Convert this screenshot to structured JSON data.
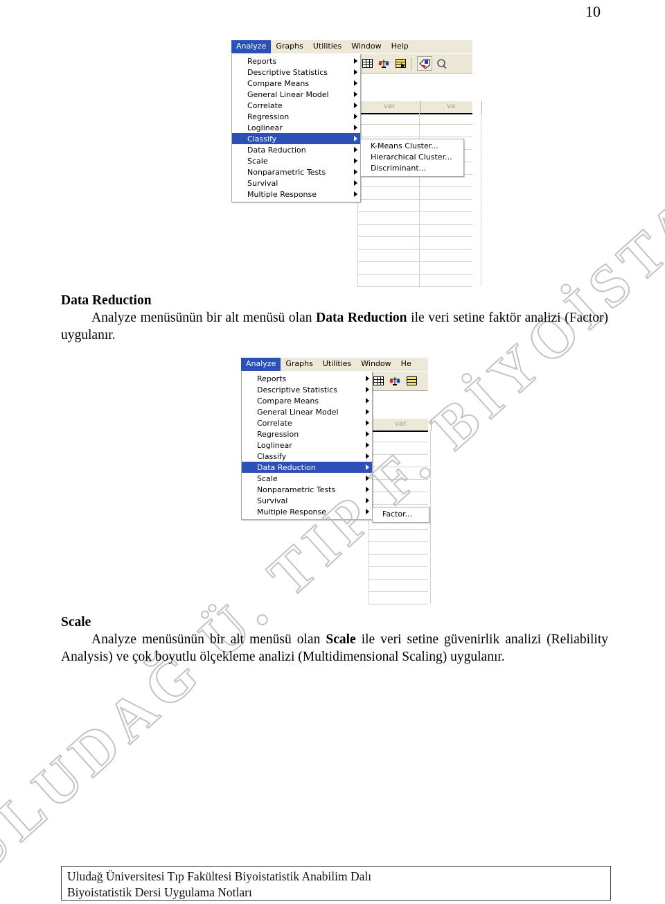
{
  "page": {
    "number": "10",
    "watermark": "ULUDAĞ Ü. TIP F. BİYOİSTATİSTİK A.D."
  },
  "screenshot_classify": {
    "name": "spss-analyze-menu-classify",
    "menubar": [
      {
        "label": "Analyze",
        "active": true
      },
      {
        "label": "Graphs",
        "active": false
      },
      {
        "label": "Utilities",
        "active": false
      },
      {
        "label": "Window",
        "active": false
      },
      {
        "label": "Help",
        "active": false
      }
    ],
    "menu_items": [
      {
        "label": "Reports",
        "selected": false
      },
      {
        "label": "Descriptive Statistics",
        "selected": false
      },
      {
        "label": "Compare Means",
        "selected": false
      },
      {
        "label": "General Linear Model",
        "selected": false
      },
      {
        "label": "Correlate",
        "selected": false
      },
      {
        "label": "Regression",
        "selected": false
      },
      {
        "label": "Loglinear",
        "selected": false
      },
      {
        "label": "Classify",
        "selected": true
      },
      {
        "label": "Data Reduction",
        "selected": false
      },
      {
        "label": "Scale",
        "selected": false
      },
      {
        "label": "Nonparametric Tests",
        "selected": false
      },
      {
        "label": "Survival",
        "selected": false
      },
      {
        "label": "Multiple Response",
        "selected": false
      }
    ],
    "submenu_items": [
      {
        "label": "K-Means Cluster..."
      },
      {
        "label": "Hierarchical Cluster..."
      },
      {
        "label": "Discriminant..."
      }
    ],
    "column_headers": [
      "var",
      "va"
    ],
    "toolbar_icons": [
      "data-grid-icon",
      "weighted-cases-icon",
      "insert-variable-icon",
      "value-labels-icon",
      "find-icon"
    ]
  },
  "screenshot_datareduction": {
    "name": "spss-analyze-menu-data-reduction",
    "menubar": [
      {
        "label": "Analyze",
        "active": true
      },
      {
        "label": "Graphs",
        "active": false
      },
      {
        "label": "Utilities",
        "active": false
      },
      {
        "label": "Window",
        "active": false
      },
      {
        "label": "He",
        "active": false
      }
    ],
    "menu_items": [
      {
        "label": "Reports",
        "selected": false
      },
      {
        "label": "Descriptive Statistics",
        "selected": false
      },
      {
        "label": "Compare Means",
        "selected": false
      },
      {
        "label": "General Linear Model",
        "selected": false
      },
      {
        "label": "Correlate",
        "selected": false
      },
      {
        "label": "Regression",
        "selected": false
      },
      {
        "label": "Loglinear",
        "selected": false
      },
      {
        "label": "Classify",
        "selected": false
      },
      {
        "label": "Data Reduction",
        "selected": true
      },
      {
        "label": "Scale",
        "selected": false
      },
      {
        "label": "Nonparametric Tests",
        "selected": false
      },
      {
        "label": "Survival",
        "selected": false
      },
      {
        "label": "Multiple Response",
        "selected": false
      }
    ],
    "submenu_items": [
      {
        "label": "Factor..."
      }
    ],
    "column_headers": [
      "var"
    ],
    "toolbar_icons": [
      "data-grid-icon",
      "weighted-cases-icon",
      "insert-variable-icon"
    ]
  },
  "section_data_reduction": {
    "heading": "Data Reduction",
    "paragraph_pre": "Analyze menüsünün bir alt menüsü olan ",
    "paragraph_bold": "Data Reduction",
    "paragraph_post": " ile veri setine faktör analizi (Factor) uygulanır."
  },
  "section_scale": {
    "heading": "Scale",
    "paragraph_pre": "Analyze menüsünün bir alt menüsü olan ",
    "paragraph_bold": "Scale",
    "paragraph_post": " ile veri setine güvenirlik analizi (Reliability Analysis) ve çok boyutlu ölçekleme analizi (Multidimensional Scaling) uygulanır."
  },
  "footer": {
    "line1": "Uludağ Üniversitesi Tıp Fakültesi Biyoistatistik Anabilim Dalı",
    "line2": "Biyoistatistik Dersi Uygulama Notları"
  },
  "colors": {
    "menu_highlight": "#2b50b8",
    "menu_face": "#ece9d8",
    "grid_line": "#d4d0c8",
    "watermark": "#b9b9b9"
  }
}
